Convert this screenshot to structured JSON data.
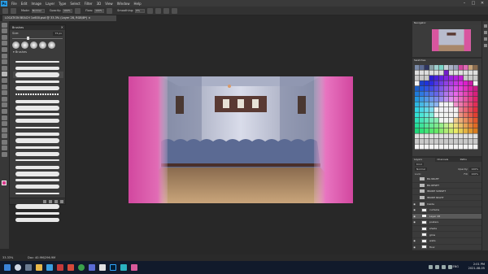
{
  "menubar": {
    "logo": "Ps",
    "items": [
      "File",
      "Edit",
      "Image",
      "Layer",
      "Type",
      "Select",
      "Filter",
      "3D",
      "View",
      "Window",
      "Help"
    ],
    "window_controls": [
      "–",
      "□",
      "✕"
    ]
  },
  "options": {
    "mode_label": "Mode:",
    "mode_value": "Normal",
    "opacity_label": "Opacity:",
    "opacity_value": "100%",
    "flow_label": "Flow:",
    "flow_value": "100%",
    "smoothing_label": "Smoothing:",
    "smoothing_value": "0%"
  },
  "document": {
    "tab_title": "LOCATION BEACH 1x600.psd @ 33.3% (Layer 28, RGB/8*) ×"
  },
  "brushes_panel": {
    "title": "Brushes",
    "close": "✕",
    "size_label": "Size:",
    "size_value": "75 px",
    "folder_label": "Brushes",
    "brush_count": 25,
    "selected_index": 2
  },
  "layers_panel": {
    "tabs": [
      "Layers",
      "Channels",
      "Paths"
    ],
    "kind_label": "Kind",
    "blend_mode": "Normal",
    "opacity_label": "Opacity:",
    "opacity_value": "100%",
    "lock_label": "Lock:",
    "fill_label": "Fill:",
    "fill_value": "100%",
    "layers": [
      {
        "name": "BG NIGHT",
        "type": "folder",
        "visible": false
      },
      {
        "name": "BG RESET",
        "type": "folder",
        "visible": false
      },
      {
        "name": "INSIDE SUNSET",
        "type": "folder",
        "visible": false
      },
      {
        "name": "INSIDE NIGHT",
        "type": "folder",
        "visible": false
      },
      {
        "name": "Inside",
        "type": "folder",
        "visible": true
      },
      {
        "name": "curtains",
        "type": "layer",
        "visible": true
      },
      {
        "name": "Layer 28",
        "type": "layer",
        "visible": true,
        "selected": true
      },
      {
        "name": "posters",
        "type": "layer",
        "visible": true
      },
      {
        "name": "shade",
        "type": "layer",
        "visible": false
      },
      {
        "name": "glow",
        "type": "layer",
        "visible": false
      },
      {
        "name": "walls",
        "type": "layer",
        "visible": true
      },
      {
        "name": "floor",
        "type": "layer",
        "visible": true
      }
    ]
  },
  "right_panels": {
    "navigator_tab": "Navigator",
    "swatches_tab": "Swatches"
  },
  "status": {
    "zoom": "33.33%",
    "doc_info": "Doc: 40.9M/296.9M"
  },
  "taskbar": {
    "lang": "ENG",
    "time": "2:01 PM",
    "date": "2021-08-05"
  },
  "colors": {
    "foreground": "#d83a8c",
    "background": "#ffffff",
    "accent": "#2b9fe8"
  }
}
